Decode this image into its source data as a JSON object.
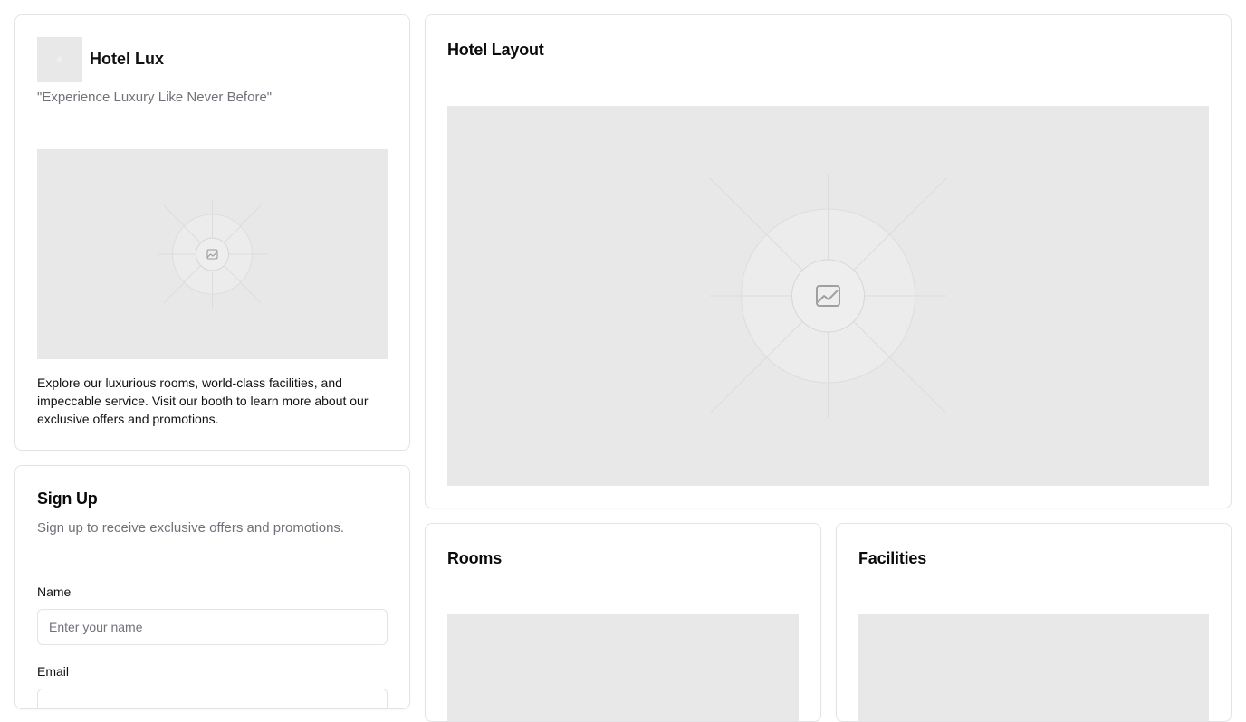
{
  "hotel": {
    "name": "Hotel Lux",
    "tagline": "\"Experience Luxury Like Never Before\"",
    "description": "Explore our luxurious rooms, world-class facilities, and impeccable service. Visit our booth to learn more about our exclusive offers and promotions.",
    "logo_icon": "image-placeholder-icon",
    "image_icon": "image-placeholder-icon"
  },
  "signup": {
    "title": "Sign Up",
    "description": "Sign up to receive exclusive offers and promotions.",
    "name_label": "Name",
    "name_placeholder": "Enter your name",
    "email_label": "Email",
    "email_placeholder": ""
  },
  "layout": {
    "title": "Hotel Layout",
    "image_icon": "image-placeholder-icon"
  },
  "rooms": {
    "title": "Rooms",
    "image_icon": "image-placeholder-icon"
  },
  "facilities": {
    "title": "Facilities",
    "image_icon": "image-placeholder-icon"
  },
  "colors": {
    "placeholder_bg": "#e8e8e8",
    "border": "#e4e4e7",
    "muted_text": "#71717a"
  }
}
